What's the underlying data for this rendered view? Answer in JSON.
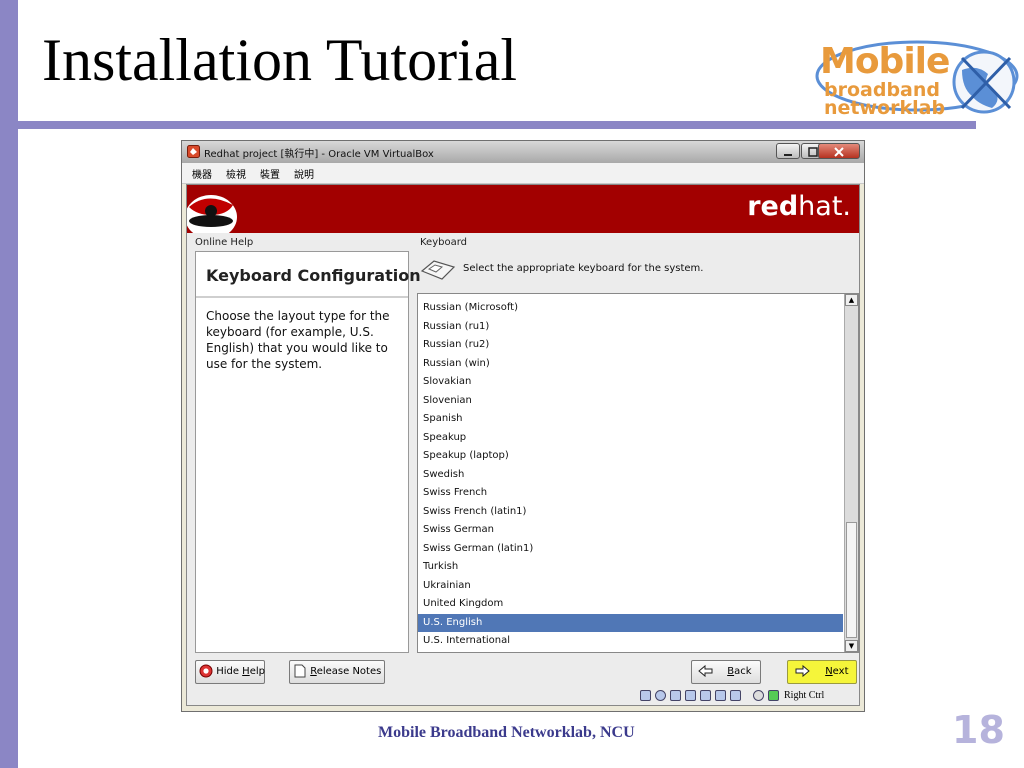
{
  "slide": {
    "title": "Installation Tutorial",
    "footer": "Mobile Broadband Networklab, NCU",
    "page_number": "18",
    "logo": {
      "line1": "Mobile",
      "line2": "broadband",
      "line3": "networklab"
    },
    "colors": {
      "accent": "#8b86c5",
      "logo_orange": "#e89a3c",
      "footer_blue": "#3b3a8c"
    }
  },
  "window": {
    "title": "Redhat project [執行中] - Oracle VM VirtualBox",
    "menu": [
      "機器",
      "檢視",
      "裝置",
      "說明"
    ],
    "controls": [
      "minimize-icon",
      "maximize-icon",
      "close-icon"
    ]
  },
  "installer": {
    "brand_bold": "red",
    "brand_light": "hat.",
    "online_help_label": "Online Help",
    "help_title": "Keyboard Configuration",
    "help_text": "Choose the layout type for the keyboard (for example, U.S. English) that you would like to use for the system.",
    "keyboard_label": "Keyboard",
    "instruction": "Select the appropriate keyboard for the system.",
    "layouts": [
      "Russian (Microsoft)",
      "Russian (ru1)",
      "Russian (ru2)",
      "Russian (win)",
      "Slovakian",
      "Slovenian",
      "Spanish",
      "Speakup",
      "Speakup (laptop)",
      "Swedish",
      "Swiss French",
      "Swiss French (latin1)",
      "Swiss German",
      "Swiss German (latin1)",
      "Turkish",
      "Ukrainian",
      "United Kingdom",
      "U.S. English",
      "U.S. International"
    ],
    "selected_layout": "U.S. English",
    "buttons": {
      "hide_help_pre": "Hide ",
      "hide_help_key": "H",
      "hide_help_post": "elp",
      "release_notes_key": "R",
      "release_notes_post": "elease Notes",
      "back_key": "B",
      "back_post": "ack",
      "next_key": "N",
      "next_post": "ext"
    },
    "host_key": "Right Ctrl"
  }
}
